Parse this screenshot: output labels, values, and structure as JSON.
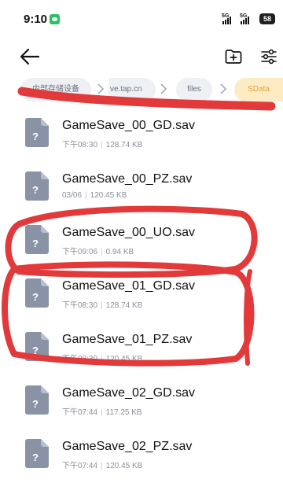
{
  "status_bar": {
    "time": "9:10",
    "signal1": "5G",
    "signal2": "5G",
    "battery": "58"
  },
  "toolbar": {
    "back_icon": "arrow-left-icon",
    "new_folder_icon": "folder-plus-icon",
    "filter_icon": "sliders-icon"
  },
  "breadcrumb": [
    {
      "label": "内部存储设备"
    },
    {
      "label": "ve.tap.cn"
    },
    {
      "label": "files"
    },
    {
      "label": "SData"
    }
  ],
  "files": [
    {
      "name": "GameSave_00_GD.sav",
      "date": "下午08:30",
      "size": "128.74 KB"
    },
    {
      "name": "GameSave_00_PZ.sav",
      "date": "03/06",
      "size": "120.45 KB"
    },
    {
      "name": "GameSave_00_UO.sav",
      "date": "下午09:06",
      "size": "0.94 KB"
    },
    {
      "name": "GameSave_01_GD.sav",
      "date": "下午08:30",
      "size": "128.74 KB"
    },
    {
      "name": "GameSave_01_PZ.sav",
      "date": "下午08:30",
      "size": "120.45 KB"
    },
    {
      "name": "GameSave_02_GD.sav",
      "date": "下午07:44",
      "size": "117.25 KB"
    },
    {
      "name": "GameSave_02_PZ.sav",
      "date": "下午07:44",
      "size": "120.45 KB"
    }
  ],
  "file_icon": "unknown-file-icon",
  "colors": {
    "annotation_red": "#e23a3a",
    "active_chip_bg": "#fdebc4",
    "active_chip_text": "#e2a23a",
    "file_icon": "#8a93a6"
  }
}
